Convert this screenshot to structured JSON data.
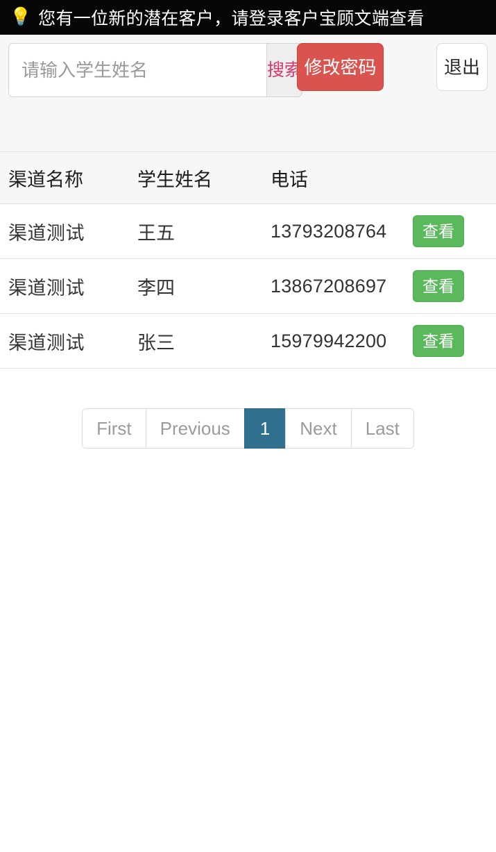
{
  "notice": {
    "icon": "lightbulb-icon",
    "icon_glyph": "💡",
    "text": "您有一位新的潜在客户，请登录客户宝顾文端查看",
    "background_color": "#070707",
    "text_color": "#ffffff"
  },
  "toolbar": {
    "search_placeholder": "请输入学生姓名",
    "search_value": "",
    "search_button_label": "搜索",
    "search_button_text_color": "#d9396b",
    "change_password_label": "修改密码",
    "change_password_color": "#d9534f",
    "logout_label": "退出"
  },
  "table": {
    "headers": [
      "渠道名称",
      "学生姓名",
      "电话",
      ""
    ],
    "action_label": "查看",
    "action_color": "#5cb85c",
    "rows": [
      {
        "channel": "渠道测试",
        "name": "王五",
        "phone": "13793208764",
        "action": "查看"
      },
      {
        "channel": "渠道测试",
        "name": "李四",
        "phone": "13867208697",
        "action": "查看"
      },
      {
        "channel": "渠道测试",
        "name": "张三",
        "phone": "15979942200",
        "action": "查看"
      }
    ]
  },
  "pagination": {
    "first_label": "First",
    "previous_label": "Previous",
    "current_page": "1",
    "next_label": "Next",
    "last_label": "Last",
    "active_color": "#31708f"
  }
}
